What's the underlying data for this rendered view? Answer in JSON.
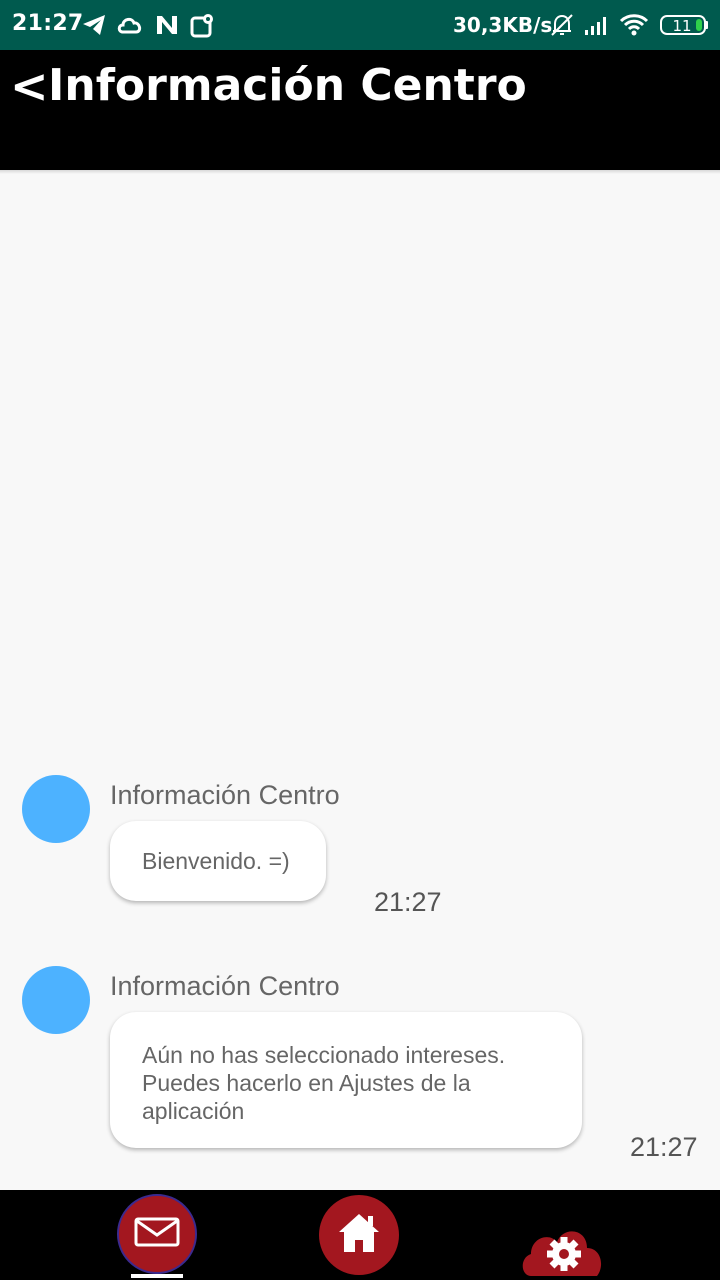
{
  "status_bar": {
    "time": "21:27",
    "network_speed": "30,3KB/s",
    "battery_level": "11",
    "left_icons": [
      "telegram-icon",
      "cloud-icon",
      "n-icon",
      "location-icon"
    ],
    "right_icons": [
      "bell-muted-icon",
      "signal-icon",
      "wifi-icon",
      "battery-icon"
    ]
  },
  "app_bar": {
    "back_label": "<",
    "title": "Información Centro"
  },
  "messages": [
    {
      "sender": "Información Centro",
      "lines": [
        "Bienvenido. =)"
      ],
      "time": "21:27"
    },
    {
      "sender": "Información Centro",
      "lines": [
        "Aún no has seleccionado intereses.",
        "Puedes hacerlo en Ajustes de la",
        "aplicación"
      ],
      "time": "21:27"
    }
  ],
  "bottom_nav": {
    "items": [
      {
        "icon": "mail-icon",
        "selected": true
      },
      {
        "icon": "home-icon",
        "selected": false
      },
      {
        "icon": "settings-cloud-icon",
        "selected": false
      }
    ]
  },
  "colors": {
    "status_bar": "#005a4e",
    "app_bar": "#000000",
    "background": "#f8f8f8",
    "avatar": "#4db2ff",
    "accent": "#a3171f"
  }
}
